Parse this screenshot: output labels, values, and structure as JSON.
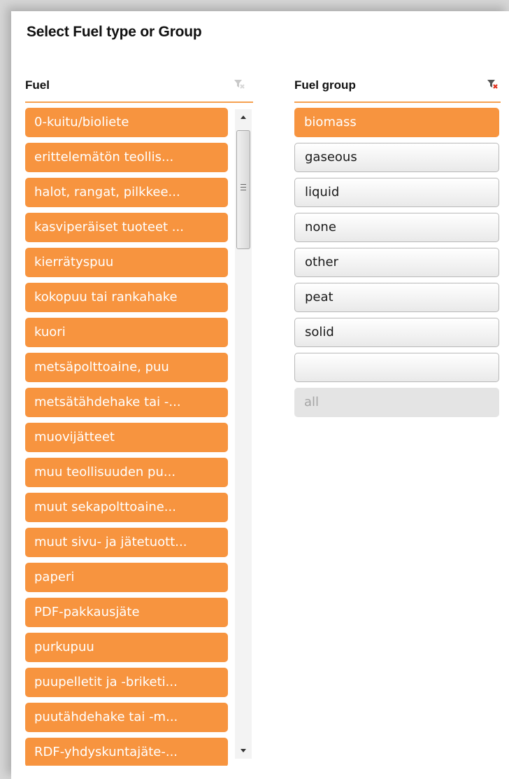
{
  "panel": {
    "title": "Select Fuel type or Group"
  },
  "fuel": {
    "header": "Fuel",
    "clear_icon": "clear-filter-icon",
    "items": [
      "0-kuitu/bioliete",
      "erittelemätön teollis...",
      "halot, rangat, pilkkee...",
      "kasviperäiset tuoteet ...",
      "kierrätyspuu",
      "kokopuu tai rankahake",
      "kuori",
      "metsäpolttoaine, puu",
      "metsätähdehake tai -...",
      "muovijätteet",
      "muu teollisuuden pu...",
      "muut sekapolttoaine...",
      "muut sivu- ja jätetuott...",
      "paperi",
      "PDF-pakkausjäte",
      "purkupuu",
      "puupelletit ja -briketi...",
      "puutähdehake tai -m...",
      "RDF-yhdyskuntajäte-..."
    ]
  },
  "fuel_group": {
    "header": "Fuel group",
    "clear_icon": "clear-filter-icon",
    "items": [
      {
        "label": "biomass",
        "state": "selected"
      },
      {
        "label": "gaseous",
        "state": "normal"
      },
      {
        "label": "liquid",
        "state": "normal"
      },
      {
        "label": "none",
        "state": "normal"
      },
      {
        "label": "other",
        "state": "normal"
      },
      {
        "label": "peat",
        "state": "normal"
      },
      {
        "label": "solid",
        "state": "normal"
      },
      {
        "label": "",
        "state": "normal"
      },
      {
        "label": "all",
        "state": "disabled"
      }
    ]
  },
  "colors": {
    "accent": "#f7943f",
    "rule": "#f5a04f",
    "disabled_text": "#a5a5a5"
  }
}
